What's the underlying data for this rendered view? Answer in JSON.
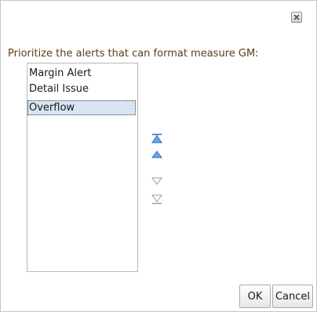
{
  "dialog": {
    "prompt": "Prioritize the alerts that can format measure GM:",
    "alerts": [
      {
        "label": "Margin Alert",
        "selected": false
      },
      {
        "label": "Detail Issue",
        "selected": false
      },
      {
        "label": "Overflow",
        "selected": true
      }
    ],
    "ok_label": "OK",
    "cancel_label": "Cancel"
  },
  "icons": {
    "close": "close-icon",
    "move_top": "move-to-top-icon",
    "move_up": "move-up-icon",
    "move_down": "move-down-icon",
    "move_bottom": "move-to-bottom-icon"
  },
  "colors": {
    "prompt_text": "#5a3e18",
    "selection": "#d6e4f3",
    "mover_active": "#2f6fb8",
    "mover_disabled": "#9a9a9a"
  }
}
